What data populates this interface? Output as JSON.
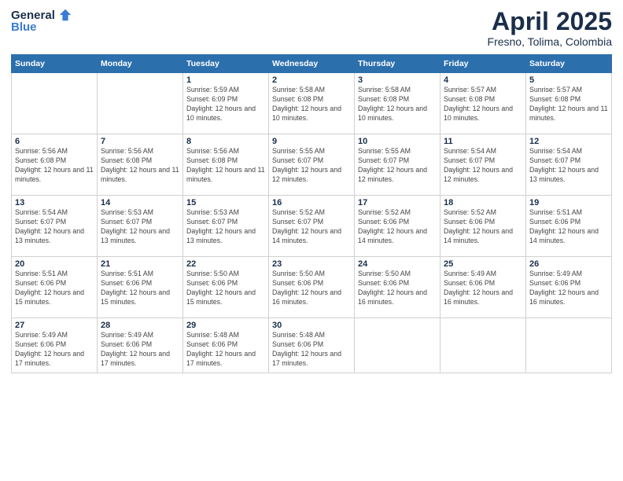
{
  "logo": {
    "general": "General",
    "blue": "Blue"
  },
  "title": "April 2025",
  "subtitle": "Fresno, Tolima, Colombia",
  "days_of_week": [
    "Sunday",
    "Monday",
    "Tuesday",
    "Wednesday",
    "Thursday",
    "Friday",
    "Saturday"
  ],
  "weeks": [
    [
      {
        "day": "",
        "info": ""
      },
      {
        "day": "",
        "info": ""
      },
      {
        "day": "1",
        "info": "Sunrise: 5:59 AM\nSunset: 6:09 PM\nDaylight: 12 hours and 10 minutes."
      },
      {
        "day": "2",
        "info": "Sunrise: 5:58 AM\nSunset: 6:08 PM\nDaylight: 12 hours and 10 minutes."
      },
      {
        "day": "3",
        "info": "Sunrise: 5:58 AM\nSunset: 6:08 PM\nDaylight: 12 hours and 10 minutes."
      },
      {
        "day": "4",
        "info": "Sunrise: 5:57 AM\nSunset: 6:08 PM\nDaylight: 12 hours and 10 minutes."
      },
      {
        "day": "5",
        "info": "Sunrise: 5:57 AM\nSunset: 6:08 PM\nDaylight: 12 hours and 11 minutes."
      }
    ],
    [
      {
        "day": "6",
        "info": "Sunrise: 5:56 AM\nSunset: 6:08 PM\nDaylight: 12 hours and 11 minutes."
      },
      {
        "day": "7",
        "info": "Sunrise: 5:56 AM\nSunset: 6:08 PM\nDaylight: 12 hours and 11 minutes."
      },
      {
        "day": "8",
        "info": "Sunrise: 5:56 AM\nSunset: 6:08 PM\nDaylight: 12 hours and 11 minutes."
      },
      {
        "day": "9",
        "info": "Sunrise: 5:55 AM\nSunset: 6:07 PM\nDaylight: 12 hours and 12 minutes."
      },
      {
        "day": "10",
        "info": "Sunrise: 5:55 AM\nSunset: 6:07 PM\nDaylight: 12 hours and 12 minutes."
      },
      {
        "day": "11",
        "info": "Sunrise: 5:54 AM\nSunset: 6:07 PM\nDaylight: 12 hours and 12 minutes."
      },
      {
        "day": "12",
        "info": "Sunrise: 5:54 AM\nSunset: 6:07 PM\nDaylight: 12 hours and 13 minutes."
      }
    ],
    [
      {
        "day": "13",
        "info": "Sunrise: 5:54 AM\nSunset: 6:07 PM\nDaylight: 12 hours and 13 minutes."
      },
      {
        "day": "14",
        "info": "Sunrise: 5:53 AM\nSunset: 6:07 PM\nDaylight: 12 hours and 13 minutes."
      },
      {
        "day": "15",
        "info": "Sunrise: 5:53 AM\nSunset: 6:07 PM\nDaylight: 12 hours and 13 minutes."
      },
      {
        "day": "16",
        "info": "Sunrise: 5:52 AM\nSunset: 6:07 PM\nDaylight: 12 hours and 14 minutes."
      },
      {
        "day": "17",
        "info": "Sunrise: 5:52 AM\nSunset: 6:06 PM\nDaylight: 12 hours and 14 minutes."
      },
      {
        "day": "18",
        "info": "Sunrise: 5:52 AM\nSunset: 6:06 PM\nDaylight: 12 hours and 14 minutes."
      },
      {
        "day": "19",
        "info": "Sunrise: 5:51 AM\nSunset: 6:06 PM\nDaylight: 12 hours and 14 minutes."
      }
    ],
    [
      {
        "day": "20",
        "info": "Sunrise: 5:51 AM\nSunset: 6:06 PM\nDaylight: 12 hours and 15 minutes."
      },
      {
        "day": "21",
        "info": "Sunrise: 5:51 AM\nSunset: 6:06 PM\nDaylight: 12 hours and 15 minutes."
      },
      {
        "day": "22",
        "info": "Sunrise: 5:50 AM\nSunset: 6:06 PM\nDaylight: 12 hours and 15 minutes."
      },
      {
        "day": "23",
        "info": "Sunrise: 5:50 AM\nSunset: 6:06 PM\nDaylight: 12 hours and 16 minutes."
      },
      {
        "day": "24",
        "info": "Sunrise: 5:50 AM\nSunset: 6:06 PM\nDaylight: 12 hours and 16 minutes."
      },
      {
        "day": "25",
        "info": "Sunrise: 5:49 AM\nSunset: 6:06 PM\nDaylight: 12 hours and 16 minutes."
      },
      {
        "day": "26",
        "info": "Sunrise: 5:49 AM\nSunset: 6:06 PM\nDaylight: 12 hours and 16 minutes."
      }
    ],
    [
      {
        "day": "27",
        "info": "Sunrise: 5:49 AM\nSunset: 6:06 PM\nDaylight: 12 hours and 17 minutes."
      },
      {
        "day": "28",
        "info": "Sunrise: 5:49 AM\nSunset: 6:06 PM\nDaylight: 12 hours and 17 minutes."
      },
      {
        "day": "29",
        "info": "Sunrise: 5:48 AM\nSunset: 6:06 PM\nDaylight: 12 hours and 17 minutes."
      },
      {
        "day": "30",
        "info": "Sunrise: 5:48 AM\nSunset: 6:06 PM\nDaylight: 12 hours and 17 minutes."
      },
      {
        "day": "",
        "info": ""
      },
      {
        "day": "",
        "info": ""
      },
      {
        "day": "",
        "info": ""
      }
    ]
  ]
}
